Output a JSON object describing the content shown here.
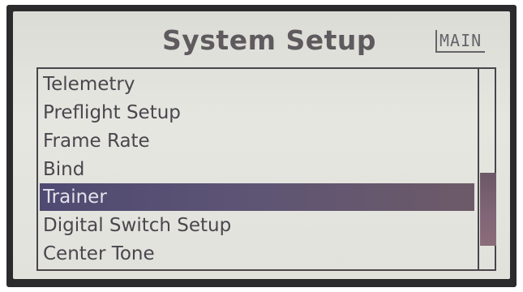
{
  "screen": {
    "title": "System Setup",
    "mode_tag": "MAIN"
  },
  "menu": {
    "items": [
      {
        "label": "Telemetry",
        "selected": false
      },
      {
        "label": "Preflight Setup",
        "selected": false
      },
      {
        "label": "Frame Rate",
        "selected": false
      },
      {
        "label": "Bind",
        "selected": false
      },
      {
        "label": "Trainer",
        "selected": true
      },
      {
        "label": "Digital Switch Setup",
        "selected": false
      },
      {
        "label": "Center Tone",
        "selected": false
      }
    ]
  },
  "colors": {
    "lcd_background": "#e2e2dc",
    "text": "#4a464e",
    "selection_highlight": "#5e5574",
    "scroll_thumb": "#816677"
  }
}
